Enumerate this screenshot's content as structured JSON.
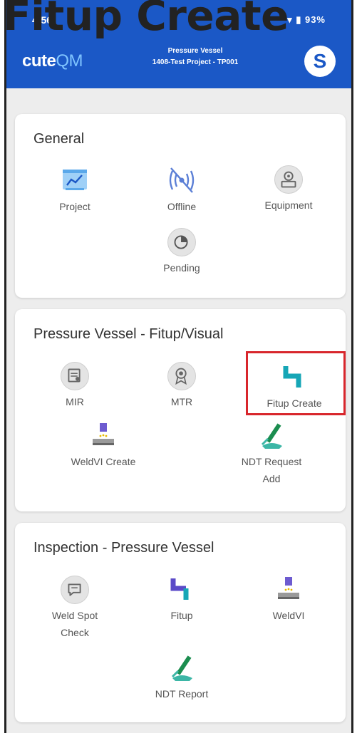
{
  "overlay_title": "Fitup Create",
  "status_bar": {
    "time": "4:56",
    "right": "⋯ ▾ ▮ 93%"
  },
  "app_bar": {
    "logo_part1": "cute",
    "logo_part2": "QM",
    "project_line1": "Pressure Vessel",
    "project_line2": "1408-Test Project - TP001",
    "avatar_letter": "S"
  },
  "sections": {
    "general": {
      "title": "General",
      "items": [
        "Project",
        "Offline",
        "Equipment",
        "Pending"
      ]
    },
    "pv_fitup": {
      "title": "Pressure Vessel - Fitup/Visual",
      "items": [
        "MIR",
        "MTR",
        "Fitup Create",
        "WeldVI Create",
        "NDT Request",
        "Add"
      ]
    },
    "inspection": {
      "title": "Inspection - Pressure Vessel",
      "items": [
        "Weld Spot",
        "Check",
        "Fitup",
        "WeldVI",
        "NDT Report"
      ]
    }
  },
  "colors": {
    "brand_blue": "#1b58c6",
    "highlight_red": "#d8262c"
  }
}
